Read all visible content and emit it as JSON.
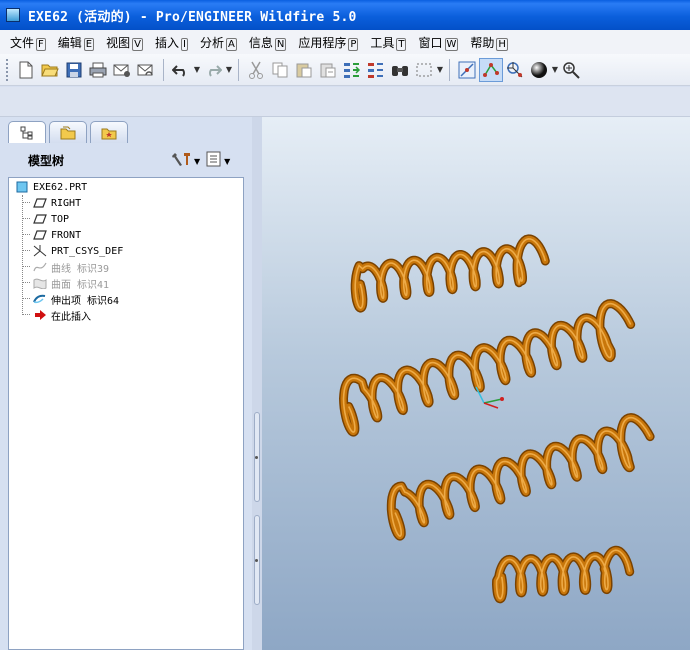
{
  "window": {
    "title": "EXE62 (活动的) - Pro/ENGINEER Wildfire 5.0"
  },
  "menu": [
    {
      "label": "文件",
      "key": "F"
    },
    {
      "label": "编辑",
      "key": "E"
    },
    {
      "label": "视图",
      "key": "V"
    },
    {
      "label": "插入",
      "key": "I"
    },
    {
      "label": "分析",
      "key": "A"
    },
    {
      "label": "信息",
      "key": "N"
    },
    {
      "label": "应用程序",
      "key": "P"
    },
    {
      "label": "工具",
      "key": "T"
    },
    {
      "label": "窗口",
      "key": "W"
    },
    {
      "label": "帮助",
      "key": "H"
    }
  ],
  "toolbar": {
    "icons": [
      "new-file-icon",
      "open-file-icon",
      "save-icon",
      "print-icon",
      "email-icon",
      "email-link-icon",
      "undo-icon",
      "redo-icon",
      "cut-icon",
      "copy-icon",
      "paste-icon",
      "paste-special-icon",
      "regenerate-icon",
      "regen-manager-icon",
      "find-icon",
      "select-box-icon",
      "spin-center-icon",
      "datum-points-icon",
      "datum-csys-icon",
      "shade-icon",
      "zoom-in-icon"
    ]
  },
  "navigator": {
    "title": "模型树",
    "tabs": [
      "model-tree-tab",
      "folder-browser-tab",
      "favorites-tab"
    ]
  },
  "model_tree": {
    "items": [
      {
        "label": "EXE62.PRT",
        "icon": "part-icon",
        "dim": false
      },
      {
        "label": "RIGHT",
        "icon": "datum-plane-icon",
        "dim": false
      },
      {
        "label": "TOP",
        "icon": "datum-plane-icon",
        "dim": false
      },
      {
        "label": "FRONT",
        "icon": "datum-plane-icon",
        "dim": false
      },
      {
        "label": "PRT_CSYS_DEF",
        "icon": "coordinate-system-icon",
        "dim": false
      },
      {
        "label": "曲线 标识39",
        "icon": "curve-icon",
        "dim": true
      },
      {
        "label": "曲面 标识41",
        "icon": "surface-icon",
        "dim": true
      },
      {
        "label": "伸出项 标识64",
        "icon": "protrusion-icon",
        "dim": false
      },
      {
        "label": "在此插入",
        "icon": "insert-here-arrow-icon",
        "dim": false
      }
    ]
  },
  "colors": {
    "title_bar": "#0b5fdc",
    "spring": "#c8760a",
    "viewport_top": "#e6eef6",
    "viewport_bottom": "#8ea7c5"
  }
}
